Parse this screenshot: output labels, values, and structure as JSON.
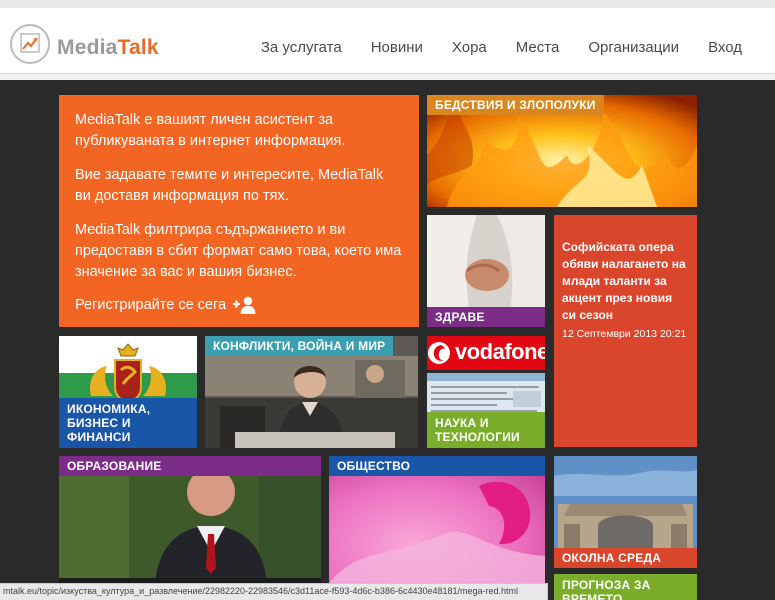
{
  "brand": {
    "part1": "Media",
    "part2": "Talk"
  },
  "nav": [
    "За услугата",
    "Новини",
    "Хора",
    "Места",
    "Организации",
    "Вход"
  ],
  "intro": {
    "p1": "MediaTalk е вашият личен асистент за публикуваната в интернет информация.",
    "p2": "Вие задавате темите и интересите, MediaTalk ви доставя информация по тях.",
    "p3": "MediaTalk филтрира съдържанието и ви предоставя в сбит формат само това, което има значение за вас и вашия бизнес.",
    "cta": "Регистрирайте се сега"
  },
  "tiles": {
    "disasters": "БЕДСТВИЯ И ЗЛОПОЛУКИ",
    "health": "ЗДРАВЕ",
    "economy": "ИКОНОМИКА, БИЗНЕС И ФИНАНСИ",
    "conflicts": "КОНФЛИКТИ, ВОЙНА И МИР",
    "science": "НАУКА И ТЕХНОЛОГИИ",
    "vodafone": "vodafone",
    "education": "ОБРАЗОВАНИЕ",
    "society": "ОБЩЕСТВО",
    "environment": "ОКОЛНА СРЕДА",
    "weather": "ПРОГНОЗА ЗА ВРЕМЕТО"
  },
  "news": {
    "headline": "Софийската опера обяви налагането на млади таланти за акцент през новия си сезон",
    "date": "12 Септември 2013 20:21"
  },
  "status_url": "mtalk.eu/topic/изкуства_култура_и_развлечение/22982220-22983546/c3d11ace-f593-4d6c-b386-6c4430e48181/mega-red.html",
  "colors": {
    "accent": "#f26522",
    "brand_orange": "#e96b2b",
    "news_red": "#d9462c",
    "disasters": "#d9861f",
    "health": "#7a2c86",
    "economy": "#1a56a8",
    "conflicts": "#3a9fb0",
    "science": "#7aae2a",
    "education": "#7a2c86",
    "society": "#1a56a8",
    "environment": "#d9462c",
    "weather": "#7aae2a"
  }
}
